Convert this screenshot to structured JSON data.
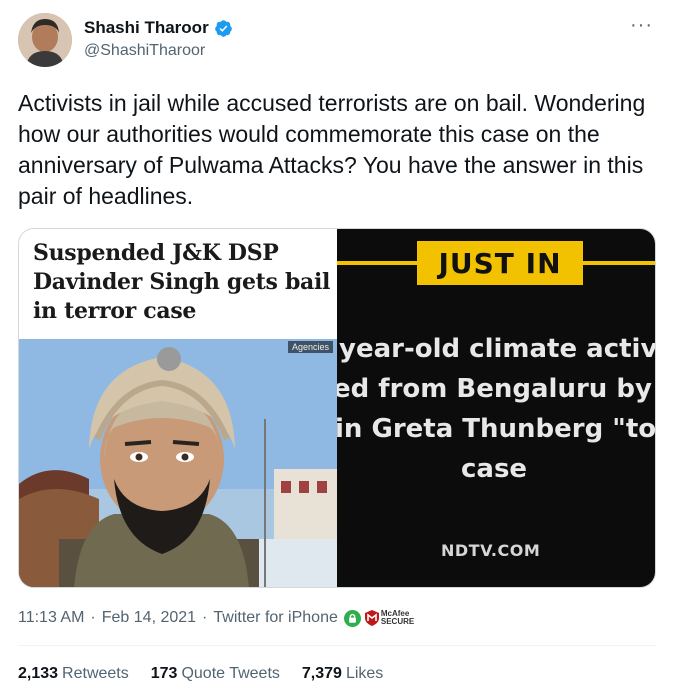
{
  "author": {
    "name": "Shashi Tharoor",
    "handle": "@ShashiTharoor"
  },
  "more_icon": "more-dots-icon",
  "tweet": {
    "text": "Activists in jail while accused terrorists are on bail. Wondering how our authorities would commemorate this case on the anniversary of Pulwama Attacks? You have the answer in this pair of headlines."
  },
  "media": {
    "left": {
      "headline": "Suspended J&K DSP Davinder Singh gets bail in terror case",
      "photo_tag": "Agencies"
    },
    "right": {
      "banner": "JUST IN",
      "line1": "year-old climate activ",
      "line2": "ed from Bengaluru by",
      "line3": "in Greta Thunberg \"to",
      "line4": "case",
      "source": "NDTV.COM"
    }
  },
  "meta": {
    "time": "11:13 AM",
    "date": "Feb 14, 2021",
    "client": "Twitter for iPhone",
    "badge_line1": "McAfee",
    "badge_line2": "SECURE"
  },
  "stats": {
    "retweets_count": "2,133",
    "retweets_label": "Retweets",
    "quotes_count": "173",
    "quotes_label": "Quote Tweets",
    "likes_count": "7,379",
    "likes_label": "Likes"
  },
  "colors": {
    "verified": "#1d9bf0",
    "secondary_text": "#536471",
    "banner_yellow": "#f2c200"
  }
}
